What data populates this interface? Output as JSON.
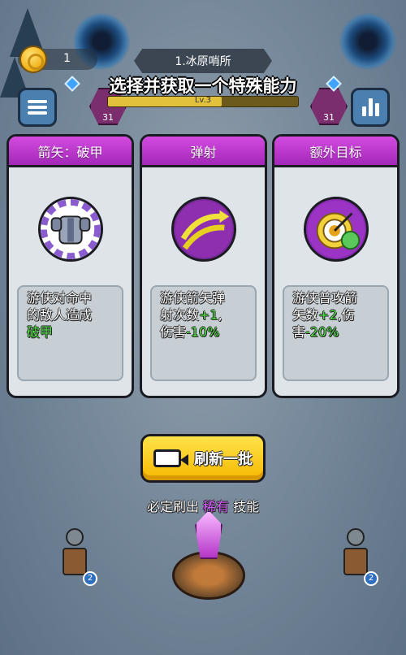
{
  "hud": {
    "coins": "1",
    "stage_name": "1.冰原哨所",
    "level_label": "Lv.3",
    "left_badge_count": "31",
    "right_badge_count": "31"
  },
  "modal": {
    "title": "选择并获取一个特殊能力"
  },
  "cards": [
    {
      "name": "箭矢：破甲",
      "desc_line1": "游侠对命中",
      "desc_line2": "的敌人造成",
      "desc_hl": "破甲",
      "icon": "armor-icon"
    },
    {
      "name": "弹射",
      "desc_line1": "游侠箭矢弹",
      "desc_line2a": "射次数",
      "desc_hl1": "+1",
      "desc_line3a": "伤害",
      "desc_hl2": "-10%",
      "desc_sep": ",",
      "icon": "bouncing-arrows-icon"
    },
    {
      "name": "额外目标",
      "desc_line1": "游侠普攻箭",
      "desc_line2a": "矢数",
      "desc_hl1": "+2",
      "desc_line2b": ",伤",
      "desc_line3a": "害",
      "desc_hl2": "-20%",
      "icon": "target-icon"
    }
  ],
  "refresh": {
    "label": "刷新一批",
    "hint_prefix": "必定刷出",
    "hint_rare": "稀有",
    "hint_suffix": "技能"
  },
  "towers": {
    "left_level": "2",
    "right_level": "2"
  },
  "colors": {
    "card_header": "#c23ad6",
    "highlight": "#54e04a",
    "rare": "#d65cff",
    "button": "#f5c400"
  }
}
